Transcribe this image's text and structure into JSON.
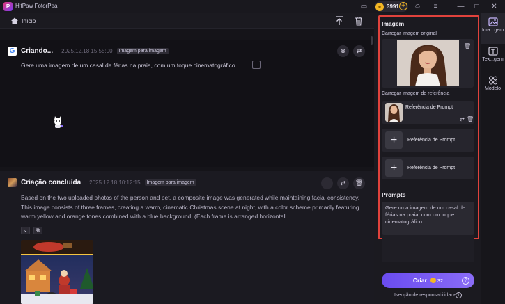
{
  "app": {
    "title": "HitPaw FotorPea",
    "credits": "3991"
  },
  "breadcrumb": {
    "label": "Início"
  },
  "tasks": [
    {
      "title": "Criando...",
      "time": "2025.12.18 15:55:00",
      "tag": "Imagem para imagem",
      "prompt": "Gere uma imagem de um casal de férias na praia, com um toque cinematográfico."
    },
    {
      "title": "Criação concluída",
      "time": "2025.12.18 10:12:15",
      "tag": "Imagem para imagem",
      "description": "Based on the two uploaded photos of the person and pet, a composite image was generated while maintaining facial consistency. This image consists of three frames, creating a warm, cinematic Christmas scene at night, with a color scheme primarily featuring warm yellow and orange tones combined with a blue background. (Each frame is arranged horizontall..."
    }
  ],
  "panel": {
    "section_image": "Imagem",
    "upload_original": "Carregar imagem original",
    "upload_reference": "Carregar imagem de referência",
    "references": [
      "Referência de Prompt",
      "Referência de Prompt",
      "Referência de Prompt"
    ],
    "section_prompts": "Prompts",
    "prompt_value": "Gere uma imagem de um casal de férias na praia, com um toque cinematográfico.",
    "create_label": "Criar",
    "create_cost": "32",
    "disclaimer": "Isenção de responsabilidade"
  },
  "sidebar": {
    "items": [
      {
        "label": "Ima...gem",
        "icon": "image-icon"
      },
      {
        "label": "Tex...gem",
        "icon": "text-image-icon"
      },
      {
        "label": "Modelo",
        "icon": "model-grid-icon"
      }
    ]
  },
  "colors": {
    "accent": "#7a5cf4",
    "highlight_border": "#e0423c",
    "coin": "#f2b624"
  }
}
